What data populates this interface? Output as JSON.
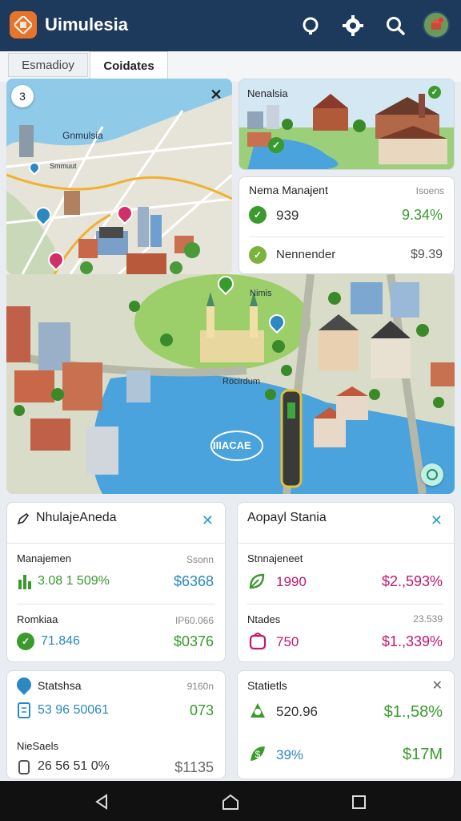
{
  "app": {
    "title": "Uimulesia"
  },
  "tabs": [
    {
      "label": "Esmadioy",
      "active": false
    },
    {
      "label": "Coidates",
      "active": true
    }
  ],
  "map": {
    "top_label": "Gnmulsia",
    "small_label": "Smmuut",
    "pin_label": "Nimis",
    "button_label": "3",
    "lake_label": "IIIACAE",
    "street_label": "Rocirdum"
  },
  "preview": {
    "title": "Nenalsia"
  },
  "summary_card": {
    "title": "Nema Manajent",
    "corner": "Isoens",
    "rows": [
      {
        "value": "939",
        "percent": "9.34%"
      },
      {
        "value": "Nennender",
        "percent": "$9.39"
      }
    ]
  },
  "card_a": {
    "title": "NhulajeAneda",
    "rows": [
      {
        "label": "Manajemen",
        "sub": "Ssonn",
        "value": "3.08 1 509%",
        "amount": "$6368"
      },
      {
        "label": "Romkiaa",
        "sub": "IP60.066",
        "value": "71.846",
        "amount": "$0376"
      }
    ]
  },
  "card_b": {
    "title": "Aopayl Stania",
    "rows": [
      {
        "label": "Stnnajeneet",
        "sub": "",
        "value": "1990",
        "amount": "$2.,593%"
      },
      {
        "label": "Ntades",
        "sub": "23.539",
        "value": "750",
        "amount": "$1.,339%"
      }
    ]
  },
  "card_c": {
    "title": "Statshsa",
    "corner": "9160n",
    "rows": [
      {
        "label": "",
        "value": "53 96 50061",
        "amount": "073"
      },
      {
        "label": "NieSaels",
        "value": "26 56 51 0%",
        "amount": "$1135"
      }
    ]
  },
  "card_d": {
    "title": "Statietls",
    "rows": [
      {
        "value": "520.96",
        "amount": "$1.,58%"
      },
      {
        "value": "39%",
        "amount": "$17M"
      }
    ]
  },
  "colors": {
    "topbar": "#1d3a5c",
    "green": "#3a9a2e",
    "blue": "#2c88c0",
    "magenta": "#c2186b",
    "water": "#4aa3dc"
  }
}
